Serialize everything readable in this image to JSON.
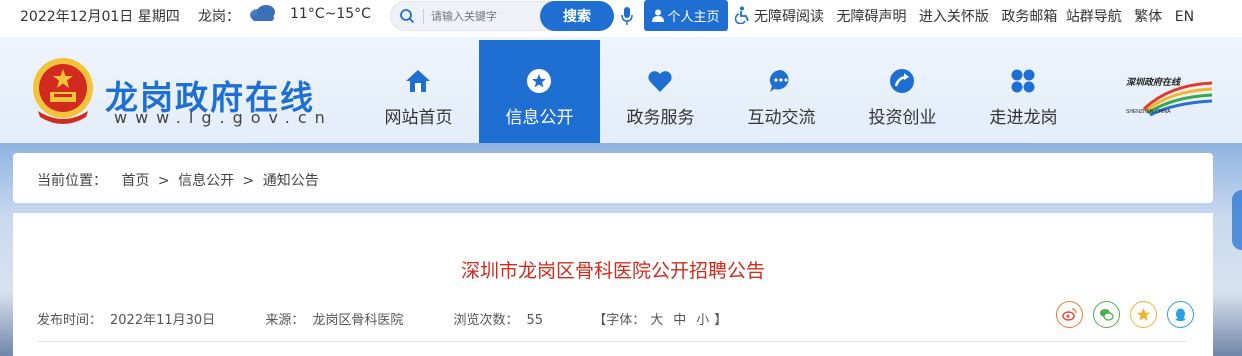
{
  "topbar": {
    "date": "2022年12月01日 星期四",
    "city": "龙岗：",
    "weather_icon": "cloud-icon",
    "temperature": "11°C~15°C",
    "search_placeholder": "请输入关键字",
    "search_button": "搜索",
    "personal_center": "个人主页",
    "links": [
      "无障碍阅读",
      "无障碍声明",
      "进入关怀版",
      "政务邮箱",
      "站群导航",
      "繁体",
      "EN"
    ]
  },
  "header": {
    "site_title": "龙岗政府在线",
    "site_url": "www.lg.gov.cn",
    "nav": [
      {
        "label": "网站首页",
        "icon": "home-icon"
      },
      {
        "label": "信息公开",
        "icon": "star-icon",
        "active": true
      },
      {
        "label": "政务服务",
        "icon": "heart-icon"
      },
      {
        "label": "互动交流",
        "icon": "chat-icon"
      },
      {
        "label": "投资创业",
        "icon": "arrow-icon"
      },
      {
        "label": "走进龙岗",
        "icon": "grid-icon"
      }
    ],
    "partner_logo_text": "深圳政府在线",
    "partner_logo_sub": "SHENZHEN CHINA"
  },
  "breadcrumb": {
    "prefix": "当前位置：",
    "items": [
      "首页",
      "信息公开",
      "通知公告"
    ],
    "separator": ">"
  },
  "article": {
    "title": "深圳市龙岗区骨科医院公开招聘公告",
    "publish_label": "发布时间：",
    "publish_date": "2022年11月30日",
    "source_label": "来源：",
    "source": "龙岗区骨科医院",
    "views_label": "浏览次数：",
    "views": "55",
    "font_label": "【字体：",
    "font_sizes": [
      "大",
      "中",
      "小"
    ],
    "font_close": "】"
  },
  "colors": {
    "brand_blue": "#1e6fd1",
    "title_red": "#d42a1e"
  }
}
